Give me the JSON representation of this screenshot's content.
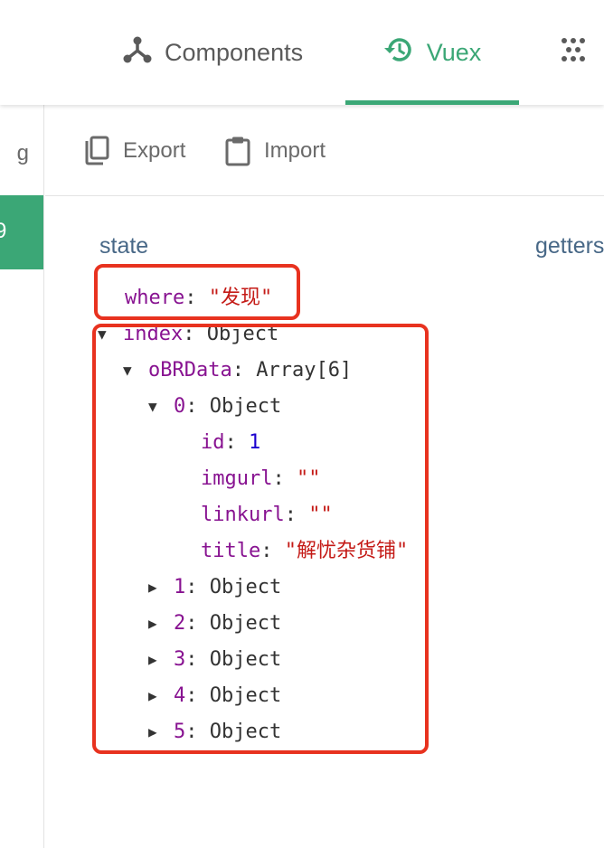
{
  "tabs": {
    "components": "Components",
    "vuex": "Vuex"
  },
  "sidebar": {
    "cut_label": "g",
    "active_cut_label": "9"
  },
  "toolbar": {
    "export": "Export",
    "import": "Import"
  },
  "headings": {
    "state": "state",
    "getters": "getters"
  },
  "state": {
    "where_key": "where",
    "where_value": "\"发现\"",
    "index_key": "index",
    "index_type": "Object",
    "obrdata_key": "oBRData",
    "obrdata_type": "Array[6]",
    "item0": {
      "key": "0",
      "type": "Object",
      "id_key": "id",
      "id_value": "1",
      "imgurl_key": "imgurl",
      "imgurl_value": "\"\"",
      "linkurl_key": "linkurl",
      "linkurl_value": "\"\"",
      "title_key": "title",
      "title_value": "\"解忧杂货铺\""
    },
    "collapsed_items": [
      {
        "key": "1",
        "type": "Object"
      },
      {
        "key": "2",
        "type": "Object"
      },
      {
        "key": "3",
        "type": "Object"
      },
      {
        "key": "4",
        "type": "Object"
      },
      {
        "key": "5",
        "type": "Object"
      }
    ]
  },
  "colors": {
    "accent": "#3ba776",
    "annotation": "#e8321f",
    "key": "#881391",
    "string": "#c41a16",
    "number": "#1c00cf"
  },
  "icons": {
    "components": "components-icon",
    "vuex": "history-icon",
    "events": "events-icon",
    "export": "copy-icon",
    "import": "clipboard-icon",
    "expanded": "triangle-down-icon",
    "collapsed": "triangle-right-icon"
  }
}
